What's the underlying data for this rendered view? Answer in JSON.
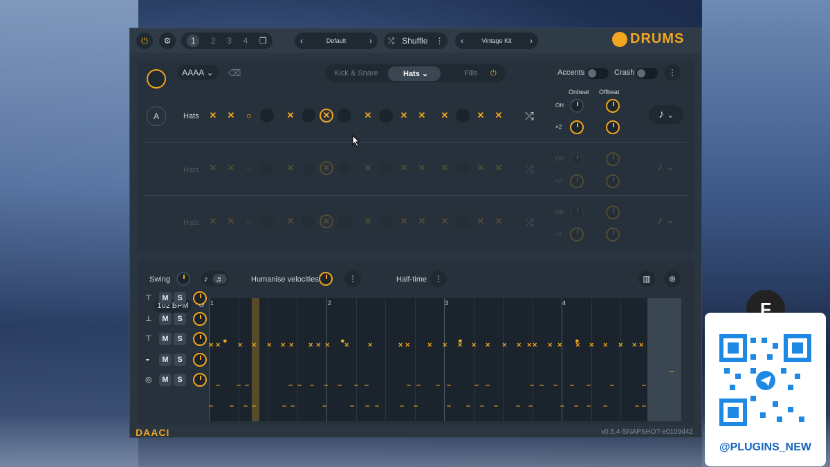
{
  "topbar": {
    "pattern_pages": [
      "1",
      "2",
      "3",
      "4"
    ],
    "preset_name": "Default",
    "shuffle_label": "Shuffle",
    "kit_name": "Vintage Kit",
    "logo_text": "DRUMS"
  },
  "panel": {
    "pattern_selector": "AAAA",
    "tabs": [
      "Kick & Snare",
      "Hats",
      "Fills"
    ],
    "active_tab": "Hats",
    "accents_label": "Accents",
    "crash_label": "Crash",
    "onbeat_label": "Onbeat",
    "offbeat_label": "Offbeat",
    "oh_label": "OH",
    "x2_label": "×2",
    "rows": [
      {
        "letter": "A",
        "name": "Hats"
      },
      {
        "letter": "",
        "name": "Hats"
      },
      {
        "letter": "",
        "name": "Hats"
      }
    ]
  },
  "lower": {
    "swing_label": "Swing",
    "humanise_label": "Humanise velocities",
    "halftime_label": "Half-time",
    "bpm": "102",
    "bpm_unit": "BPM",
    "bar_numbers": [
      "1",
      "2",
      "3",
      "4"
    ],
    "mute_label": "M",
    "solo_label": "S"
  },
  "footer": {
    "brand": "DAACI",
    "version": "v0.5.4-SNAPSHOT-e0109d42"
  },
  "overlay": {
    "handle": "@PLUGINS_NEW"
  },
  "colors": {
    "accent": "#f2a61f",
    "panel": "#26313b",
    "app_bg": "#2a3540"
  }
}
